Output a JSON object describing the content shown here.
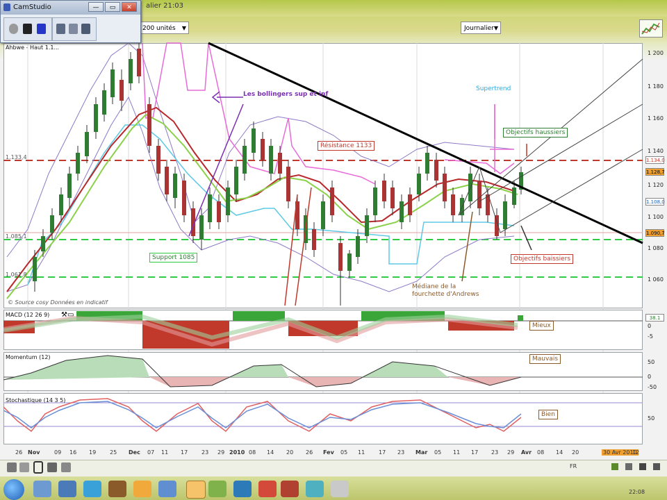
{
  "window": {
    "title_fragment": "alier 21:03"
  },
  "camstudio": {
    "title": "CamStudio",
    "buttons": {
      "minimize": "—",
      "maximize": "▭",
      "close": "✕"
    }
  },
  "controls": {
    "range": "200 unités",
    "period": "Journalier"
  },
  "main_panel": {
    "title": "Ahbwe - Haut 1.1..."
  },
  "y_axis": [
    "1 200",
    "1 180",
    "1 160",
    "1 140",
    "1 120",
    "1 100",
    "1 080",
    "1 060"
  ],
  "price_boxes": {
    "p1": "1.134,0",
    "p2": "1.128,7",
    "p3": "1.108,0",
    "p4": "1.090,7"
  },
  "hlines": {
    "resistance_value": "1.133,4",
    "support_value": "1.085,1",
    "low_value": "1.061,8"
  },
  "annotations": {
    "bollingers": "Les bollingers sup et inf",
    "supertrend": "Supertrend",
    "objectifs_haussiers": "Objectifs haussiers",
    "resistance": "Résistance 1133",
    "support": "Support 1085",
    "objectifs_baissiers": "Objectifs baissiers",
    "mediane": "Médiane de la\nfourchette d'Andrews",
    "watermark": "© Source cosy Données en indicatif"
  },
  "macd": {
    "title": "MACD (12 26 9)",
    "label": "Mieux",
    "y": [
      "0",
      "-5"
    ],
    "box": "38.1"
  },
  "momentum": {
    "title": "Momentum (12)",
    "label": "Mauvais",
    "y": [
      "50",
      "0",
      "-50"
    ]
  },
  "stochastic": {
    "title": "Stochastique (14 3 5)",
    "label": "Bien",
    "y": [
      "50"
    ]
  },
  "x_axis": [
    "26",
    "Nov",
    "09",
    "16",
    "19",
    "25",
    "Dec",
    "07",
    "11",
    "17",
    "23",
    "29",
    "2010",
    "08",
    "14",
    "20",
    "26",
    "Fev",
    "05",
    "11",
    "17",
    "23",
    "Mar",
    "05",
    "11",
    "17",
    "23",
    "29",
    "Avr",
    "08",
    "14",
    "20",
    "30 Avr 2010",
    "12"
  ],
  "tray": {
    "lang": "FR",
    "time": "22:08"
  },
  "colors": {
    "resistance": "#c0392b",
    "support": "#2ecc40",
    "trendline": "#000000",
    "bollinger": "#8e79c8",
    "supertrend": "#5ec9e6",
    "ma_red": "#b8282a",
    "ma_green": "#8bd14a",
    "magenta": "#e86ad8"
  }
}
